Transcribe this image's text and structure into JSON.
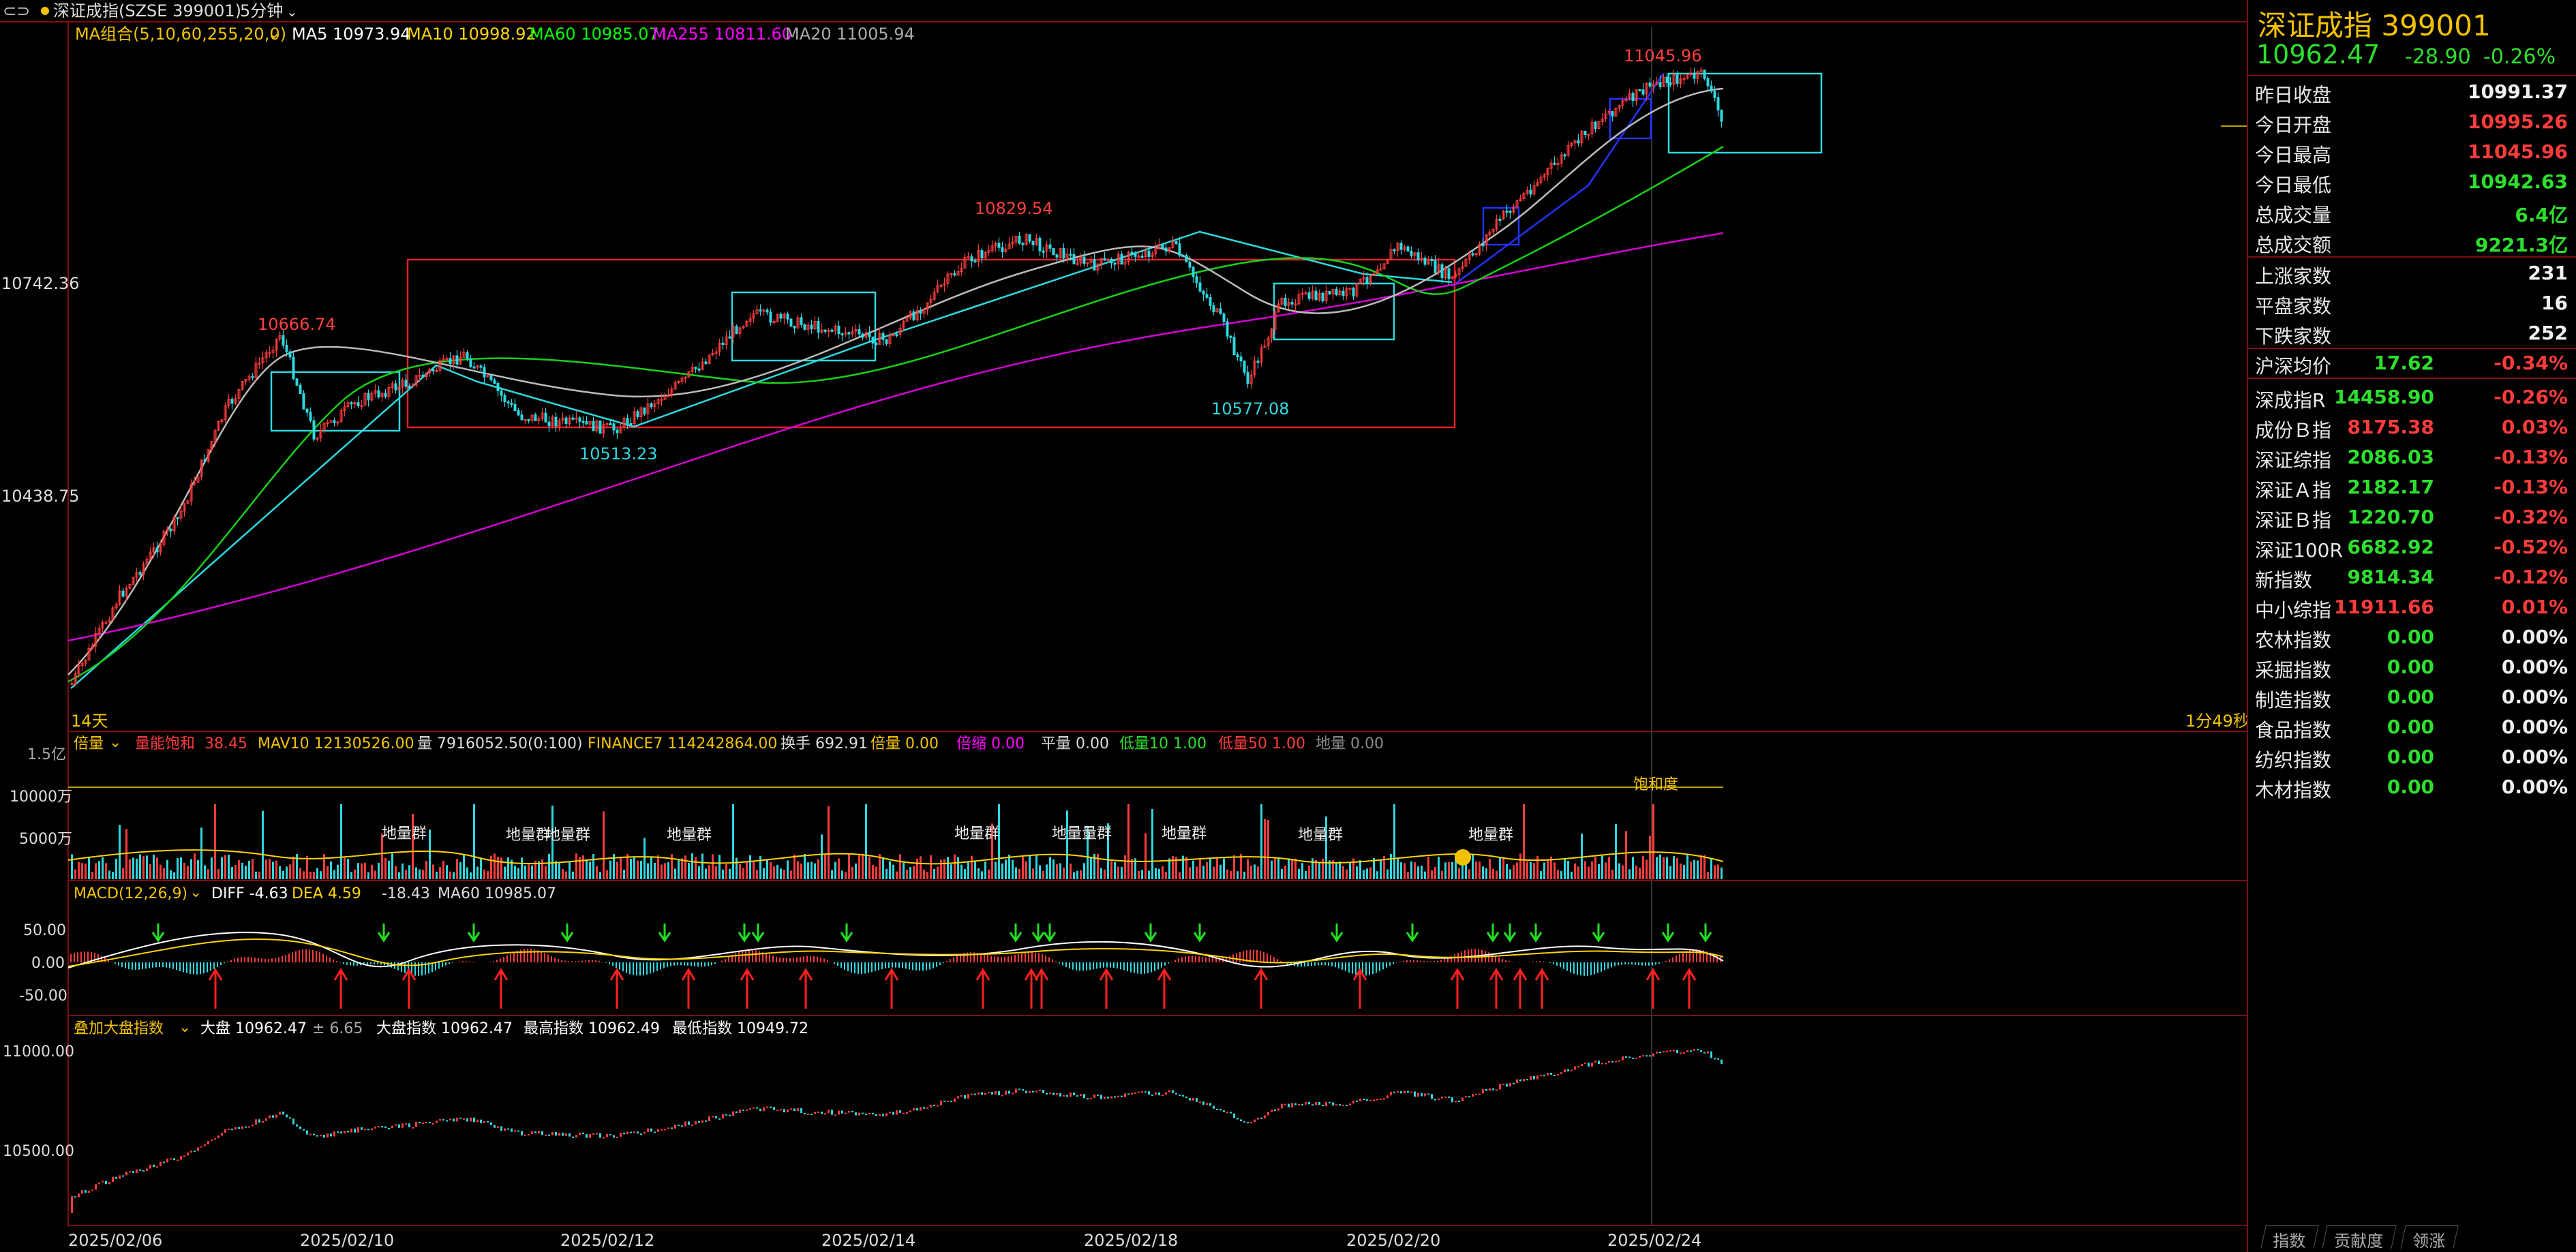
{
  "header": {
    "window_icon": "link-icon",
    "index_name": "深证成指(SZSE 399001)",
    "period": "5分钟"
  },
  "ma_bar": {
    "combo": "MA组合(5,10,60,255,20,0)",
    "ma5": "MA5 10973.94",
    "ma10": "MA10 10998.92",
    "ma60": "MA60 10985.07",
    "ma255": "MA255 10811.60",
    "ma20": "MA20 11005.94",
    "colors": {
      "ma5": "#ffffff",
      "ma10": "#ffd400",
      "ma60": "#00ff00",
      "ma255": "#ff00ff",
      "ma20": "#aaaaaa"
    }
  },
  "main_chart": {
    "y_labels": [
      "10742.36",
      "10438.75"
    ],
    "peak_labels": [
      "10666.74",
      "10513.23",
      "10829.54",
      "10577.08",
      "11045.96"
    ],
    "bottom_left": "14天",
    "bottom_right": "1分49秒"
  },
  "volume_bar": {
    "name": "倍量",
    "bnbh": "量能饱和",
    "bnbh_val": "38.45",
    "mav10": "MAV10 12130526.00",
    "liang": "量 7916052.50(0:100)",
    "finance": "FINANCE7 114242864.00",
    "huanshou": "换手 692.91",
    "beiliang": "倍量 0.00",
    "beisuo": "倍缩 0.00",
    "pingliang": "平量 0.00",
    "diliang10": "低量10 1.00",
    "diliang50": "低量50 1.00",
    "diliang": "地量 0.00",
    "y_top": "1.5亿",
    "y_mid": "10000万",
    "y_low": "5000万",
    "tag": "地量群",
    "tag2": "地量量群",
    "saturation": "饱和度"
  },
  "macd_bar": {
    "name": "MACD(12,26,9)",
    "diff": "DIFF -4.63",
    "dea": "DEA 4.59",
    "macd": "-18.43",
    "ma60": "MA60 10985.07",
    "y_labels": [
      "50.00",
      "0.00",
      "-50.00"
    ]
  },
  "overlay_bar": {
    "name": "叠加大盘指数",
    "dapan": "大盘 10962.47",
    "chg": "± 6.65",
    "dapan_index": "大盘指数 10962.47",
    "high": "最高指数 10962.49",
    "low": "最低指数 10949.72",
    "y_labels": [
      "11000.00",
      "10500.00"
    ]
  },
  "x_dates": [
    "2025/02/06",
    "2025/02/10",
    "2025/02/12",
    "2025/02/14",
    "2025/02/18",
    "2025/02/20",
    "2025/02/24"
  ],
  "side_panel": {
    "title": "深证成指  399001",
    "price": "10962.47",
    "change": "-28.90",
    "change_pct": "-0.26%",
    "stats": [
      {
        "k": "昨日收盘",
        "v": "10991.37",
        "c": "white"
      },
      {
        "k": "今日开盘",
        "v": "10995.26",
        "c": "red"
      },
      {
        "k": "今日最高",
        "v": "11045.96",
        "c": "red"
      },
      {
        "k": "今日最低",
        "v": "10942.63",
        "c": "green"
      },
      {
        "k": "总成交量",
        "v": "6.4亿",
        "c": "green"
      },
      {
        "k": "总成交额",
        "v": "9221.3亿",
        "c": "green"
      }
    ],
    "breadth": [
      {
        "k": "上涨家数",
        "v": "231"
      },
      {
        "k": "平盘家数",
        "v": "16"
      },
      {
        "k": "下跌家数",
        "v": "252"
      }
    ],
    "hs": {
      "k": "沪深均价",
      "m": "17.62",
      "v": "-0.34%"
    },
    "indices": [
      {
        "k": "深成指R",
        "m": "14458.90",
        "mc": "green",
        "v": "-0.26%",
        "vc": "red"
      },
      {
        "k": "成份Ｂ指",
        "m": "8175.38",
        "mc": "red",
        "v": "0.03%",
        "vc": "red"
      },
      {
        "k": "深证综指",
        "m": "2086.03",
        "mc": "green",
        "v": "-0.13%",
        "vc": "red"
      },
      {
        "k": "深证Ａ指",
        "m": "2182.17",
        "mc": "green",
        "v": "-0.13%",
        "vc": "red"
      },
      {
        "k": "深证Ｂ指",
        "m": "1220.70",
        "mc": "green",
        "v": "-0.32%",
        "vc": "red"
      },
      {
        "k": "深证100R",
        "m": "6682.92",
        "mc": "green",
        "v": "-0.52%",
        "vc": "red"
      },
      {
        "k": "新指数",
        "m": "9814.34",
        "mc": "green",
        "v": "-0.12%",
        "vc": "red"
      },
      {
        "k": "中小综指",
        "m": "11911.66",
        "mc": "red",
        "v": "0.01%",
        "vc": "red"
      },
      {
        "k": "农林指数",
        "m": "0.00",
        "mc": "green",
        "v": "0.00%",
        "vc": "white"
      },
      {
        "k": "采掘指数",
        "m": "0.00",
        "mc": "green",
        "v": "0.00%",
        "vc": "white"
      },
      {
        "k": "制造指数",
        "m": "0.00",
        "mc": "green",
        "v": "0.00%",
        "vc": "white"
      },
      {
        "k": "食品指数",
        "m": "0.00",
        "mc": "green",
        "v": "0.00%",
        "vc": "white"
      },
      {
        "k": "纺织指数",
        "m": "0.00",
        "mc": "green",
        "v": "0.00%",
        "vc": "white"
      },
      {
        "k": "木材指数",
        "m": "0.00",
        "mc": "green",
        "v": "0.00%",
        "vc": "white"
      }
    ],
    "tabs": [
      "指数",
      "贡献度",
      "领涨"
    ]
  }
}
